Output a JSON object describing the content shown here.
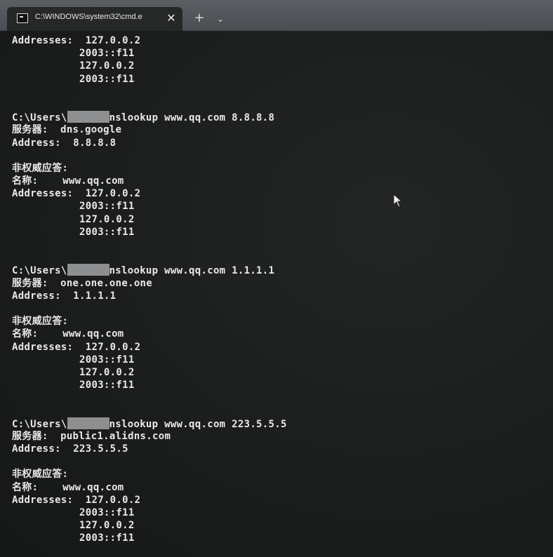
{
  "window": {
    "tab_title": "C:\\WINDOWS\\system32\\cmd.e",
    "close_glyph": "✕",
    "new_tab_glyph": "+",
    "dropdown_glyph": "⌄"
  },
  "terminal": {
    "lines": [
      "Addresses:  127.0.0.2",
      "           2003::f11",
      "           127.0.0.2",
      "           2003::f11",
      "",
      "",
      "C:\\Users\\",
      "服务器:  dns.google",
      "Address:  8.8.8.8",
      "",
      "非权威应答:",
      "名称:    www.qq.com",
      "Addresses:  127.0.0.2",
      "           2003::f11",
      "           127.0.0.2",
      "           2003::f11",
      "",
      "",
      "C:\\Users\\",
      "服务器:  one.one.one.one",
      "Address:  1.1.1.1",
      "",
      "非权威应答:",
      "名称:    www.qq.com",
      "Addresses:  127.0.0.2",
      "           2003::f11",
      "           127.0.0.2",
      "           2003::f11",
      "",
      "",
      "C:\\Users\\",
      "服务器:  public1.alidns.com",
      "Address:  223.5.5.5",
      "",
      "非权威应答:",
      "名称:    www.qq.com",
      "Addresses:  127.0.0.2",
      "           2003::f11",
      "           127.0.0.2",
      "           2003::f11"
    ],
    "commands": [
      "nslookup www.qq.com 8.8.8.8",
      "nslookup www.qq.com 1.1.1.1",
      "nslookup www.qq.com 223.5.5.5"
    ]
  },
  "colors": {
    "terminal_bg": "#1b1d1d",
    "text": "#e9e9e9",
    "titlebar": "#4f5357",
    "redaction": "#8e8f90"
  }
}
